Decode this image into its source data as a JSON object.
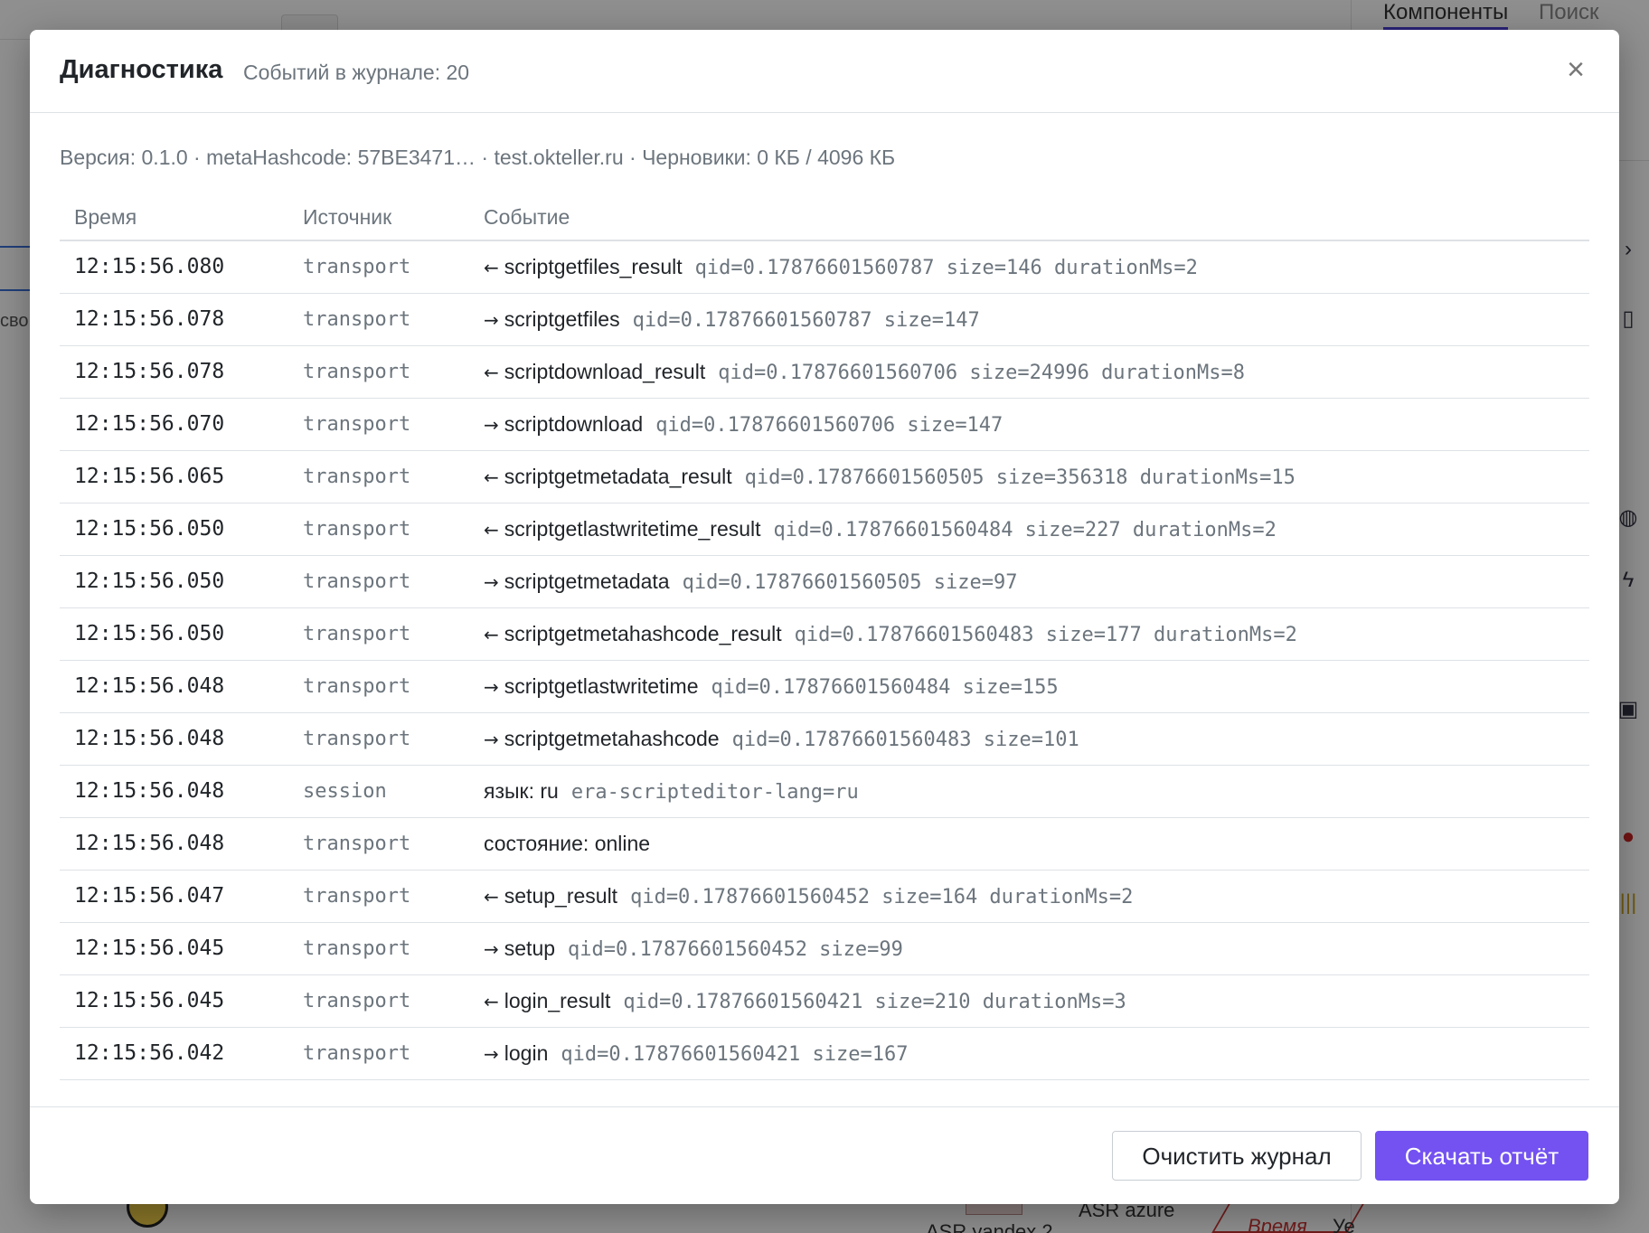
{
  "background": {
    "tabs": [
      "Компоненты",
      "Поиск"
    ],
    "left_text": "сво",
    "bottom_labels": [
      "ASR azure",
      "ASR yandex 2",
      "Время",
      "Уе"
    ]
  },
  "dialog": {
    "title": "Диагностика",
    "subtitle": "Событий в журнале: 20",
    "close_label": "×",
    "info": "Версия: 0.1.0 · metaHashcode: 57BE3471… · test.okteller.ru · Черновики: 0 КБ / 4096 КБ",
    "columns": {
      "time": "Время",
      "source": "Источник",
      "event": "Событие"
    },
    "rows": [
      {
        "time": "12:15:56.080",
        "source": "transport",
        "arrow": "←",
        "name": "scriptgetfiles_result",
        "detail": "qid=0.17876601560787 size=146 durationMs=2"
      },
      {
        "time": "12:15:56.078",
        "source": "transport",
        "arrow": "→",
        "name": "scriptgetfiles",
        "detail": "qid=0.17876601560787 size=147"
      },
      {
        "time": "12:15:56.078",
        "source": "transport",
        "arrow": "←",
        "name": "scriptdownload_result",
        "detail": "qid=0.17876601560706 size=24996 durationMs=8"
      },
      {
        "time": "12:15:56.070",
        "source": "transport",
        "arrow": "→",
        "name": "scriptdownload",
        "detail": "qid=0.17876601560706 size=147"
      },
      {
        "time": "12:15:56.065",
        "source": "transport",
        "arrow": "←",
        "name": "scriptgetmetadata_result",
        "detail": "qid=0.17876601560505 size=356318 durationMs=15"
      },
      {
        "time": "12:15:56.050",
        "source": "transport",
        "arrow": "←",
        "name": "scriptgetlastwritetime_result",
        "detail": "qid=0.17876601560484 size=227 durationMs=2"
      },
      {
        "time": "12:15:56.050",
        "source": "transport",
        "arrow": "→",
        "name": "scriptgetmetadata",
        "detail": "qid=0.17876601560505 size=97"
      },
      {
        "time": "12:15:56.050",
        "source": "transport",
        "arrow": "←",
        "name": "scriptgetmetahashcode_result",
        "detail": "qid=0.17876601560483 size=177 durationMs=2"
      },
      {
        "time": "12:15:56.048",
        "source": "transport",
        "arrow": "→",
        "name": "scriptgetlastwritetime",
        "detail": "qid=0.17876601560484 size=155"
      },
      {
        "time": "12:15:56.048",
        "source": "transport",
        "arrow": "→",
        "name": "scriptgetmetahashcode",
        "detail": "qid=0.17876601560483 size=101"
      },
      {
        "time": "12:15:56.048",
        "source": "session",
        "arrow": "",
        "name": "язык: ru",
        "detail": "era-scripteditor-lang=ru"
      },
      {
        "time": "12:15:56.048",
        "source": "transport",
        "arrow": "",
        "name": "состояние: online",
        "detail": ""
      },
      {
        "time": "12:15:56.047",
        "source": "transport",
        "arrow": "←",
        "name": "setup_result",
        "detail": "qid=0.17876601560452 size=164 durationMs=2"
      },
      {
        "time": "12:15:56.045",
        "source": "transport",
        "arrow": "→",
        "name": "setup",
        "detail": "qid=0.17876601560452 size=99"
      },
      {
        "time": "12:15:56.045",
        "source": "transport",
        "arrow": "←",
        "name": "login_result",
        "detail": "qid=0.17876601560421 size=210 durationMs=3"
      },
      {
        "time": "12:15:56.042",
        "source": "transport",
        "arrow": "→",
        "name": "login",
        "detail": "qid=0.17876601560421 size=167"
      }
    ],
    "buttons": {
      "clear": "Очистить журнал",
      "download": "Скачать отчёт"
    }
  },
  "colors": {
    "accent": "#7352f1",
    "text": "#212529",
    "muted": "#6c757d",
    "border": "#dee2e6"
  }
}
